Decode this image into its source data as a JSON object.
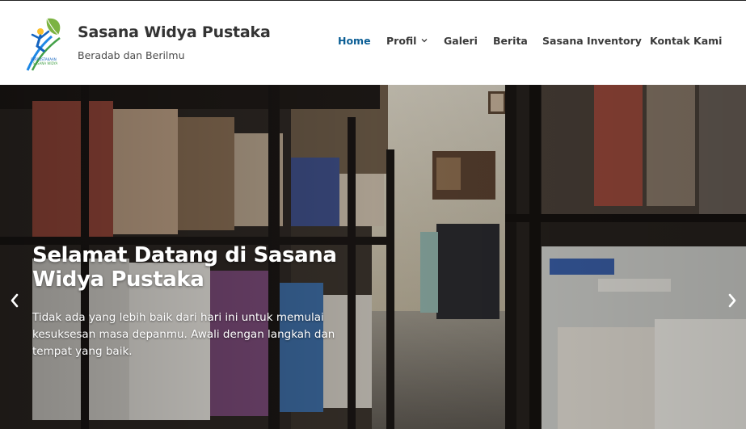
{
  "site": {
    "title": "Sasana Widya Pustaka",
    "tagline": "Beradab dan Berilmu",
    "logo_text_top": "PERPUSTAKAAN",
    "logo_text_bottom": "SASANA WIDYA"
  },
  "nav": {
    "items": [
      {
        "label": "Home",
        "active": true
      },
      {
        "label": "Profil",
        "has_dropdown": true
      },
      {
        "label": "Galeri"
      },
      {
        "label": "Berita"
      },
      {
        "label": "Sasana Inventory"
      },
      {
        "label": "Kontak Kami"
      }
    ]
  },
  "hero": {
    "title": "Selamat Datang di Sasana Widya Pustaka",
    "text": "Tidak ada yang lebih baik dari hari ini untuk memulai kesuksesan masa depanmu. Awali dengan langkah dan tempat yang baik.",
    "prev_icon": "chevron-left-icon",
    "next_icon": "chevron-right-icon"
  },
  "colors": {
    "accent": "#0b5e95",
    "nav_text": "#3a3a3a",
    "title_text": "#333333"
  }
}
